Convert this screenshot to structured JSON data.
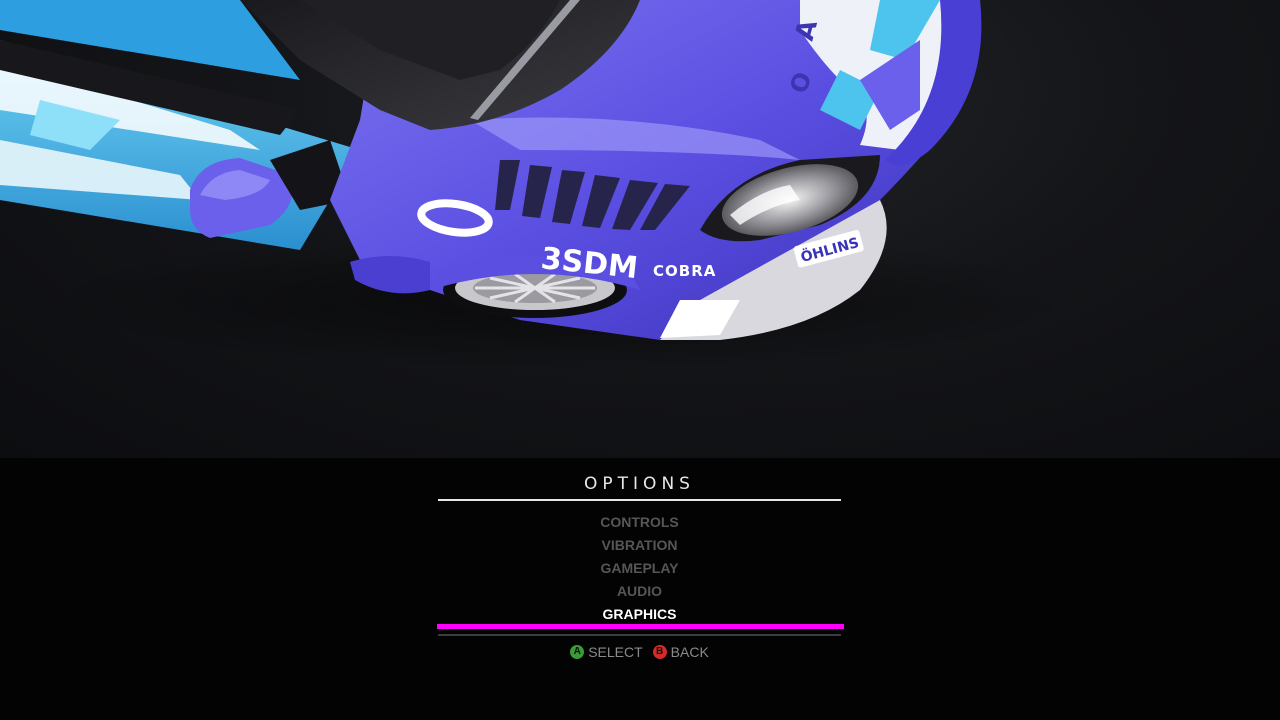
{
  "menu": {
    "title": "OPTIONS",
    "items": [
      {
        "label": "CONTROLS",
        "selected": false
      },
      {
        "label": "VIBRATION",
        "selected": false
      },
      {
        "label": "GAMEPLAY",
        "selected": false
      },
      {
        "label": "AUDIO",
        "selected": false
      },
      {
        "label": "GRAPHICS",
        "selected": true
      }
    ],
    "highlight_color": "#ff00ff"
  },
  "prompts": {
    "select": {
      "button": "A",
      "label": "SELECT",
      "color": "#3a9a35"
    },
    "back": {
      "button": "B",
      "label": "BACK",
      "color": "#d42a2a"
    }
  },
  "scene": {
    "livery_text": [
      "3SDM",
      "COBRA",
      "ÖHLINS"
    ],
    "car_color": "#5a4ee0",
    "accent_color": "#4cc4ee"
  }
}
